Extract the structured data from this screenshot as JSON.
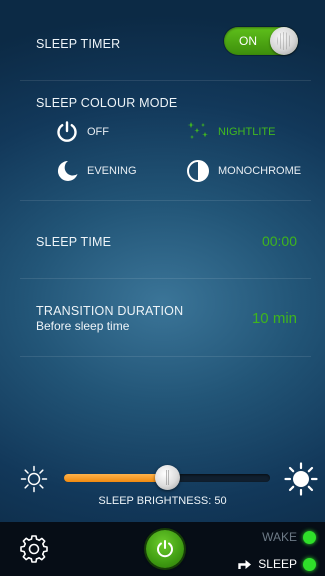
{
  "sleep_timer": {
    "label": "SLEEP TIMER",
    "toggle_label": "ON",
    "enabled": true
  },
  "colour_mode": {
    "label": "SLEEP COLOUR MODE",
    "options": [
      {
        "label": "OFF",
        "icon": "power-icon",
        "selected": false
      },
      {
        "label": "NIGHTLITE",
        "icon": "stars-icon",
        "selected": true
      },
      {
        "label": "EVENING",
        "icon": "moon-icon",
        "selected": false
      },
      {
        "label": "MONOCHROME",
        "icon": "contrast-icon",
        "selected": false
      }
    ]
  },
  "sleep_time": {
    "label": "SLEEP TIME",
    "value": "00:00"
  },
  "transition": {
    "label": "TRANSITION DURATION",
    "sublabel": "Before sleep time",
    "value": "10 min"
  },
  "brightness": {
    "caption": "SLEEP BRIGHTNESS: 50",
    "value": 50,
    "max": 100
  },
  "bottom_bar": {
    "wake_label": "WAKE",
    "sleep_label": "SLEEP",
    "icons": [
      "gear-icon",
      "power-icon",
      "arrow-turn-icon"
    ]
  },
  "colors": {
    "accent_green": "#3fb51d",
    "slider_orange": "#f08a10",
    "background": "#1b4a6b"
  }
}
